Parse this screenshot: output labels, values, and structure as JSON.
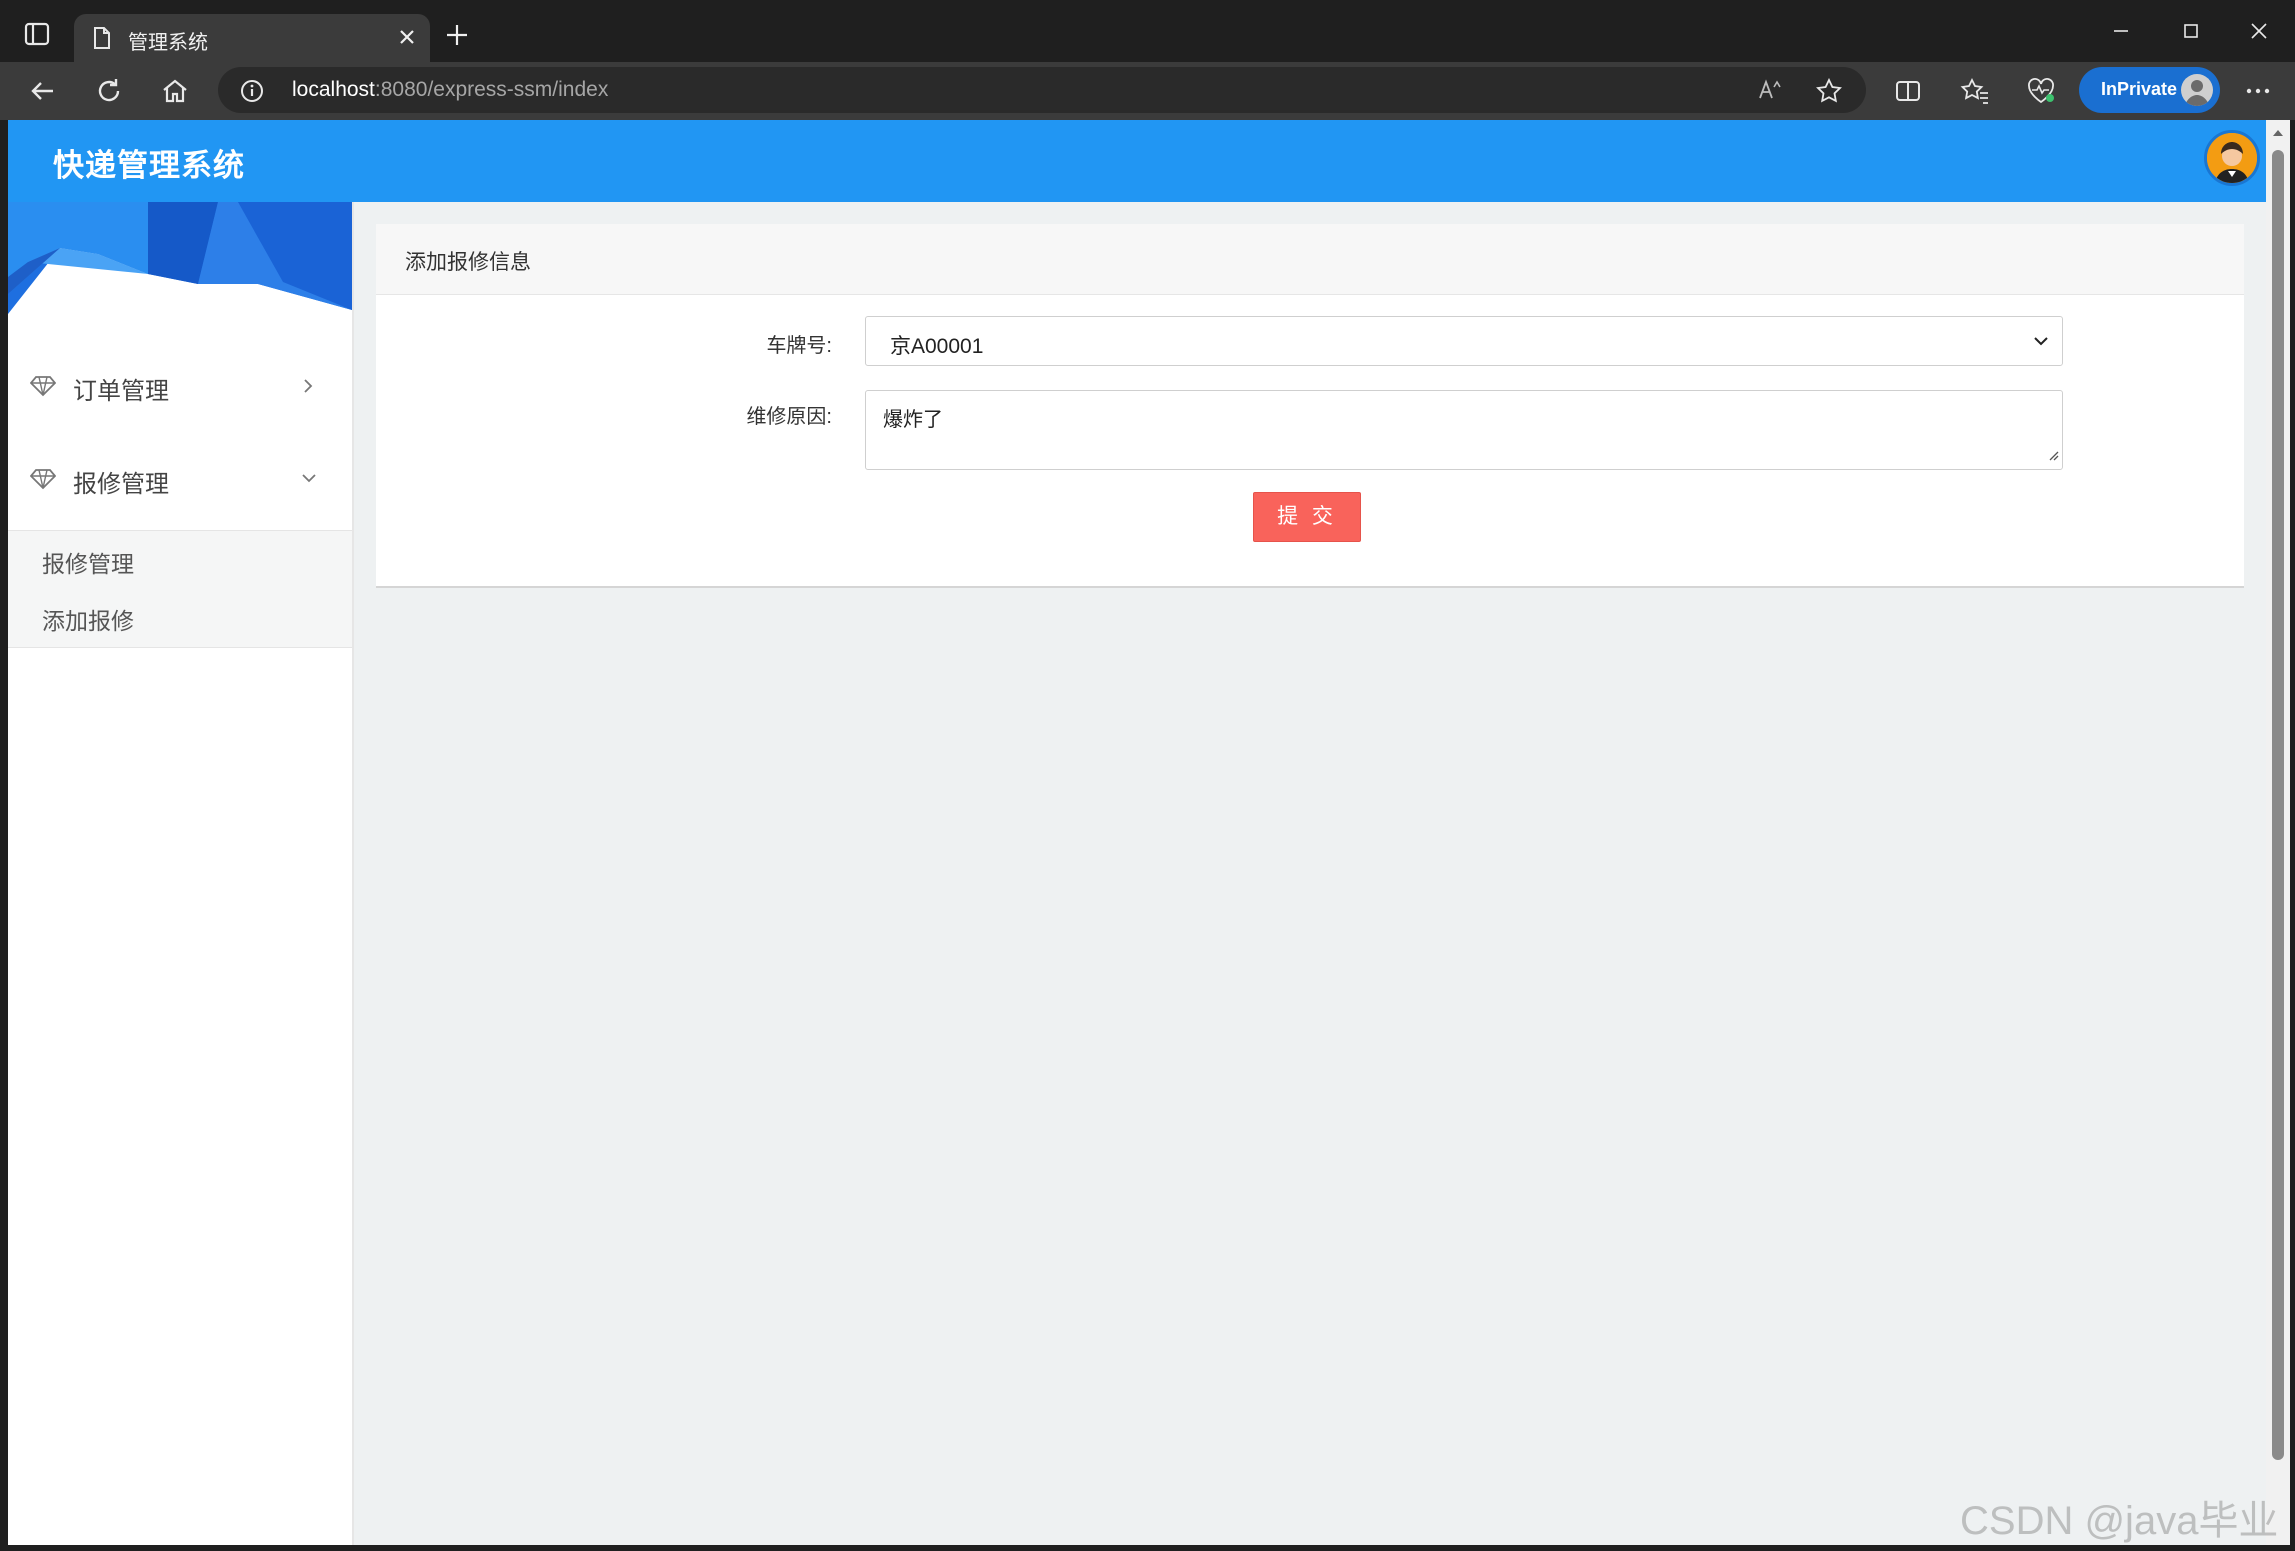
{
  "browser": {
    "tab_title": "管理系统",
    "url_host": "localhost",
    "url_rest": ":8080/express-ssm/index",
    "inprivate_label": "InPrivate"
  },
  "app": {
    "title": "快递管理系统",
    "accent_color": "#2196f3"
  },
  "sidebar": {
    "menus": [
      {
        "label": "订单管理",
        "icon": "diamond-icon",
        "expanded": false
      },
      {
        "label": "报修管理",
        "icon": "diamond-icon",
        "expanded": true
      }
    ],
    "submenu": [
      "报修管理",
      "添加报修"
    ]
  },
  "form": {
    "title": "添加报修信息",
    "plate_label": "车牌号:",
    "plate_value": "京A00001",
    "reason_label": "维修原因:",
    "reason_value": "爆炸了",
    "submit_label": "提 交",
    "submit_color": "#f9635b"
  },
  "watermark": "CSDN @java毕业"
}
